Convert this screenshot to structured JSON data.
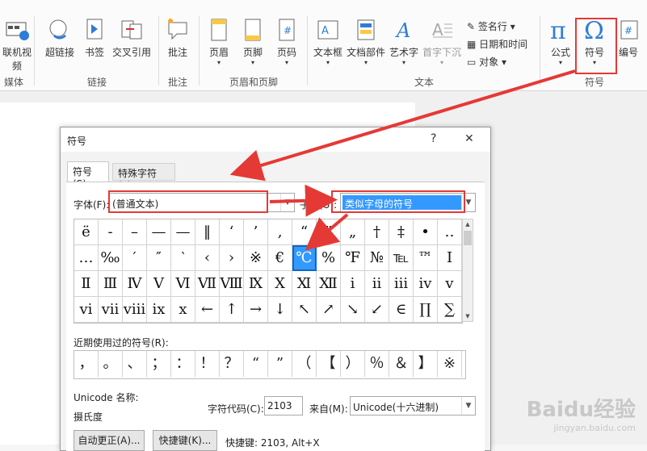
{
  "ribbon": {
    "buttons": [
      {
        "label": "联机视频",
        "icon": "online-video-icon"
      },
      {
        "label": "超链接",
        "icon": "hyperlink-icon"
      },
      {
        "label": "书签",
        "icon": "bookmark-icon"
      },
      {
        "label": "交叉引用",
        "icon": "cross-reference-icon"
      },
      {
        "label": "批注",
        "icon": "comment-icon"
      },
      {
        "label": "页眉",
        "icon": "header-icon"
      },
      {
        "label": "页脚",
        "icon": "footer-icon"
      },
      {
        "label": "页码",
        "icon": "page-number-icon"
      },
      {
        "label": "文本框",
        "icon": "text-box-icon"
      },
      {
        "label": "文档部件",
        "icon": "quick-parts-icon"
      },
      {
        "label": "艺术字",
        "icon": "wordart-icon"
      },
      {
        "label": "首字下沉",
        "icon": "drop-cap-icon"
      },
      {
        "label": "公式",
        "icon": "equation-icon"
      },
      {
        "label": "符号",
        "icon": "symbol-icon"
      },
      {
        "label": "编号",
        "icon": "numbering-icon"
      }
    ],
    "small_items": [
      "签名行",
      "日期和时间",
      "对象"
    ],
    "groups": [
      "媒体",
      "链接",
      "批注",
      "页眉和页脚",
      "文本",
      "符号"
    ]
  },
  "dialog": {
    "title": "符号",
    "help": "?",
    "close": "✕",
    "tabs": [
      "符号(S)",
      "特殊字符(P)"
    ],
    "font_label": "字体(F):",
    "font_value": "(普通文本)",
    "subset_label": "子集(U):",
    "subset_value": "类似字母的符号",
    "symbols": [
      "ë",
      "-",
      "–",
      "—",
      "—",
      "‖",
      "‘",
      "’",
      "‚",
      "“",
      "”",
      "„",
      "†",
      "‡",
      "•",
      "‥",
      "…",
      "‰",
      "′",
      "″",
      "‵",
      "‹",
      "›",
      "※",
      "€",
      "℃",
      "%",
      "℉",
      "№",
      "℡",
      "™",
      "Ⅰ",
      "Ⅱ",
      "Ⅲ",
      "Ⅳ",
      "Ⅴ",
      "Ⅵ",
      "Ⅶ",
      "Ⅷ",
      "Ⅸ",
      "Ⅹ",
      "Ⅺ",
      "Ⅻ",
      "ⅰ",
      "ⅱ",
      "ⅲ",
      "ⅳ",
      "ⅴ",
      "ⅵ",
      "ⅶ",
      "ⅷ",
      "ⅸ",
      "ⅹ",
      "←",
      "↑",
      "→",
      "↓",
      "↖",
      "↗",
      "↘",
      "↙",
      "∈",
      "∏",
      "∑"
    ],
    "selected_symbol": "℃",
    "recent_label": "近期使用过的符号(R):",
    "recent": [
      "，",
      "。",
      "、",
      "；",
      "：",
      "！",
      "？",
      "“",
      "”",
      "（",
      "【",
      "）",
      "％",
      "＆",
      "】",
      "※"
    ],
    "unicode_name_label": "Unicode 名称:",
    "unicode_name_value": "摄氏度",
    "char_code_label": "字符代码(C):",
    "char_code_value": "2103",
    "from_label": "来自(M):",
    "from_value": "Unicode(十六进制)",
    "autocorrect_btn": "自动更正(A)...",
    "shortcut_btn": "快捷键(K)...",
    "shortcut_text": "快捷键: 2103, Alt+X"
  },
  "watermark": {
    "text": "Baidu经验",
    "sub": "jingyan.baidu.com"
  },
  "colors": {
    "highlight": "#e53935",
    "selection": "#3399ff"
  }
}
